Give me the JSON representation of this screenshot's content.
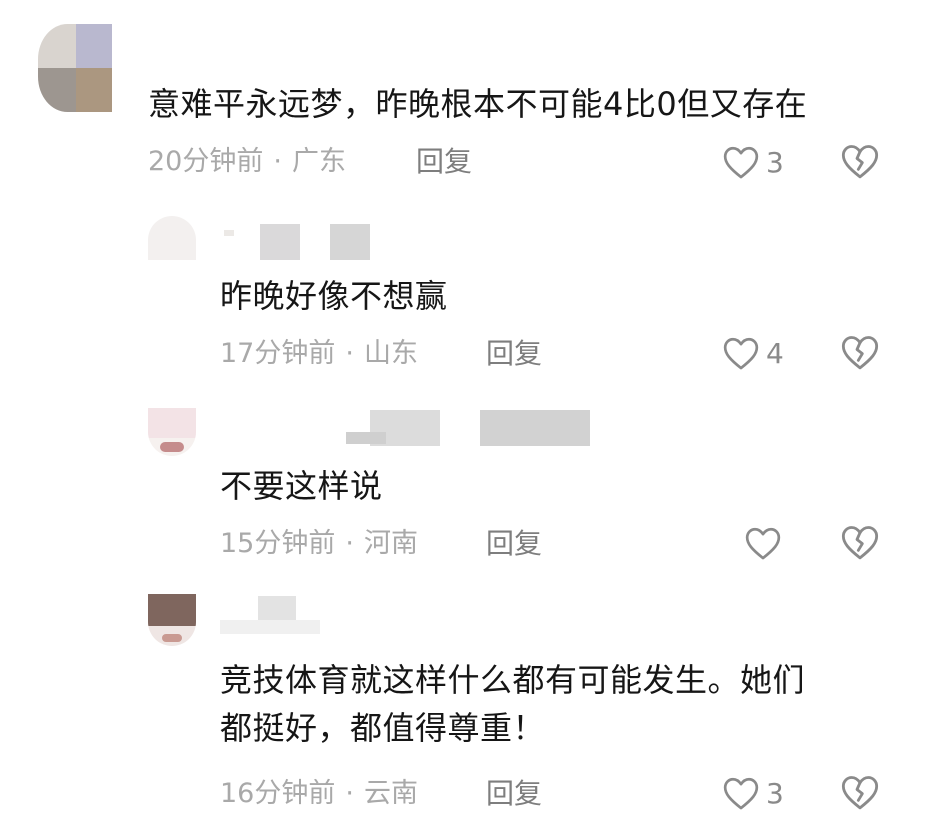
{
  "comments": [
    {
      "text": "意难平永远梦，昨晚根本不可能4比0但又存在",
      "time": "20分钟前",
      "location": "广东",
      "reply_label": "回复",
      "likes": "3"
    },
    {
      "text": "昨晚好像不想赢",
      "time": "17分钟前",
      "location": "山东",
      "reply_label": "回复",
      "likes": "4"
    },
    {
      "text": "不要这样说",
      "time": "15分钟前",
      "location": "河南",
      "reply_label": "回复",
      "likes": ""
    },
    {
      "text": "竞技体育就这样什么都有可能发生。她们\n都挺好，都值得尊重！",
      "time": "16分钟前",
      "location": "云南",
      "reply_label": "回复",
      "likes": "3"
    }
  ],
  "separator": "·",
  "icons": {
    "like": "heart-outline-icon",
    "dislike": "broken-heart-icon"
  },
  "colors": {
    "text": "#161616",
    "meta": "#a9a9a9",
    "reply": "#7e7e7e",
    "icon": "#8a8a8a"
  }
}
